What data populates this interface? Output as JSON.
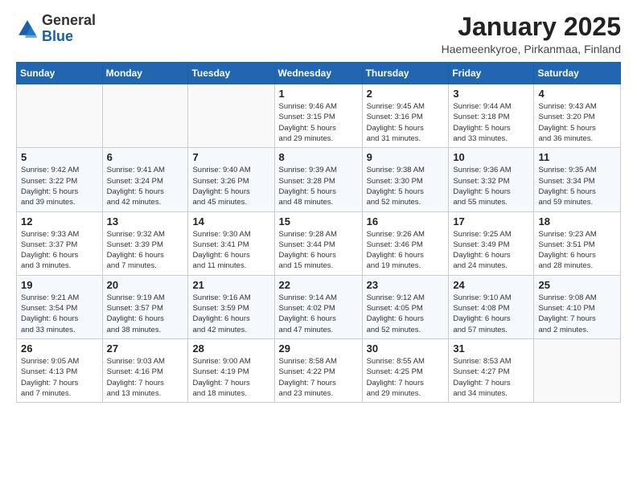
{
  "header": {
    "logo_general": "General",
    "logo_blue": "Blue",
    "month_title": "January 2025",
    "subtitle": "Haemeenkyroe, Pirkanmaa, Finland"
  },
  "weekdays": [
    "Sunday",
    "Monday",
    "Tuesday",
    "Wednesday",
    "Thursday",
    "Friday",
    "Saturday"
  ],
  "weeks": [
    [
      {
        "day": "",
        "info": ""
      },
      {
        "day": "",
        "info": ""
      },
      {
        "day": "",
        "info": ""
      },
      {
        "day": "1",
        "info": "Sunrise: 9:46 AM\nSunset: 3:15 PM\nDaylight: 5 hours\nand 29 minutes."
      },
      {
        "day": "2",
        "info": "Sunrise: 9:45 AM\nSunset: 3:16 PM\nDaylight: 5 hours\nand 31 minutes."
      },
      {
        "day": "3",
        "info": "Sunrise: 9:44 AM\nSunset: 3:18 PM\nDaylight: 5 hours\nand 33 minutes."
      },
      {
        "day": "4",
        "info": "Sunrise: 9:43 AM\nSunset: 3:20 PM\nDaylight: 5 hours\nand 36 minutes."
      }
    ],
    [
      {
        "day": "5",
        "info": "Sunrise: 9:42 AM\nSunset: 3:22 PM\nDaylight: 5 hours\nand 39 minutes."
      },
      {
        "day": "6",
        "info": "Sunrise: 9:41 AM\nSunset: 3:24 PM\nDaylight: 5 hours\nand 42 minutes."
      },
      {
        "day": "7",
        "info": "Sunrise: 9:40 AM\nSunset: 3:26 PM\nDaylight: 5 hours\nand 45 minutes."
      },
      {
        "day": "8",
        "info": "Sunrise: 9:39 AM\nSunset: 3:28 PM\nDaylight: 5 hours\nand 48 minutes."
      },
      {
        "day": "9",
        "info": "Sunrise: 9:38 AM\nSunset: 3:30 PM\nDaylight: 5 hours\nand 52 minutes."
      },
      {
        "day": "10",
        "info": "Sunrise: 9:36 AM\nSunset: 3:32 PM\nDaylight: 5 hours\nand 55 minutes."
      },
      {
        "day": "11",
        "info": "Sunrise: 9:35 AM\nSunset: 3:34 PM\nDaylight: 5 hours\nand 59 minutes."
      }
    ],
    [
      {
        "day": "12",
        "info": "Sunrise: 9:33 AM\nSunset: 3:37 PM\nDaylight: 6 hours\nand 3 minutes."
      },
      {
        "day": "13",
        "info": "Sunrise: 9:32 AM\nSunset: 3:39 PM\nDaylight: 6 hours\nand 7 minutes."
      },
      {
        "day": "14",
        "info": "Sunrise: 9:30 AM\nSunset: 3:41 PM\nDaylight: 6 hours\nand 11 minutes."
      },
      {
        "day": "15",
        "info": "Sunrise: 9:28 AM\nSunset: 3:44 PM\nDaylight: 6 hours\nand 15 minutes."
      },
      {
        "day": "16",
        "info": "Sunrise: 9:26 AM\nSunset: 3:46 PM\nDaylight: 6 hours\nand 19 minutes."
      },
      {
        "day": "17",
        "info": "Sunrise: 9:25 AM\nSunset: 3:49 PM\nDaylight: 6 hours\nand 24 minutes."
      },
      {
        "day": "18",
        "info": "Sunrise: 9:23 AM\nSunset: 3:51 PM\nDaylight: 6 hours\nand 28 minutes."
      }
    ],
    [
      {
        "day": "19",
        "info": "Sunrise: 9:21 AM\nSunset: 3:54 PM\nDaylight: 6 hours\nand 33 minutes."
      },
      {
        "day": "20",
        "info": "Sunrise: 9:19 AM\nSunset: 3:57 PM\nDaylight: 6 hours\nand 38 minutes."
      },
      {
        "day": "21",
        "info": "Sunrise: 9:16 AM\nSunset: 3:59 PM\nDaylight: 6 hours\nand 42 minutes."
      },
      {
        "day": "22",
        "info": "Sunrise: 9:14 AM\nSunset: 4:02 PM\nDaylight: 6 hours\nand 47 minutes."
      },
      {
        "day": "23",
        "info": "Sunrise: 9:12 AM\nSunset: 4:05 PM\nDaylight: 6 hours\nand 52 minutes."
      },
      {
        "day": "24",
        "info": "Sunrise: 9:10 AM\nSunset: 4:08 PM\nDaylight: 6 hours\nand 57 minutes."
      },
      {
        "day": "25",
        "info": "Sunrise: 9:08 AM\nSunset: 4:10 PM\nDaylight: 7 hours\nand 2 minutes."
      }
    ],
    [
      {
        "day": "26",
        "info": "Sunrise: 9:05 AM\nSunset: 4:13 PM\nDaylight: 7 hours\nand 7 minutes."
      },
      {
        "day": "27",
        "info": "Sunrise: 9:03 AM\nSunset: 4:16 PM\nDaylight: 7 hours\nand 13 minutes."
      },
      {
        "day": "28",
        "info": "Sunrise: 9:00 AM\nSunset: 4:19 PM\nDaylight: 7 hours\nand 18 minutes."
      },
      {
        "day": "29",
        "info": "Sunrise: 8:58 AM\nSunset: 4:22 PM\nDaylight: 7 hours\nand 23 minutes."
      },
      {
        "day": "30",
        "info": "Sunrise: 8:55 AM\nSunset: 4:25 PM\nDaylight: 7 hours\nand 29 minutes."
      },
      {
        "day": "31",
        "info": "Sunrise: 8:53 AM\nSunset: 4:27 PM\nDaylight: 7 hours\nand 34 minutes."
      },
      {
        "day": "",
        "info": ""
      }
    ]
  ]
}
